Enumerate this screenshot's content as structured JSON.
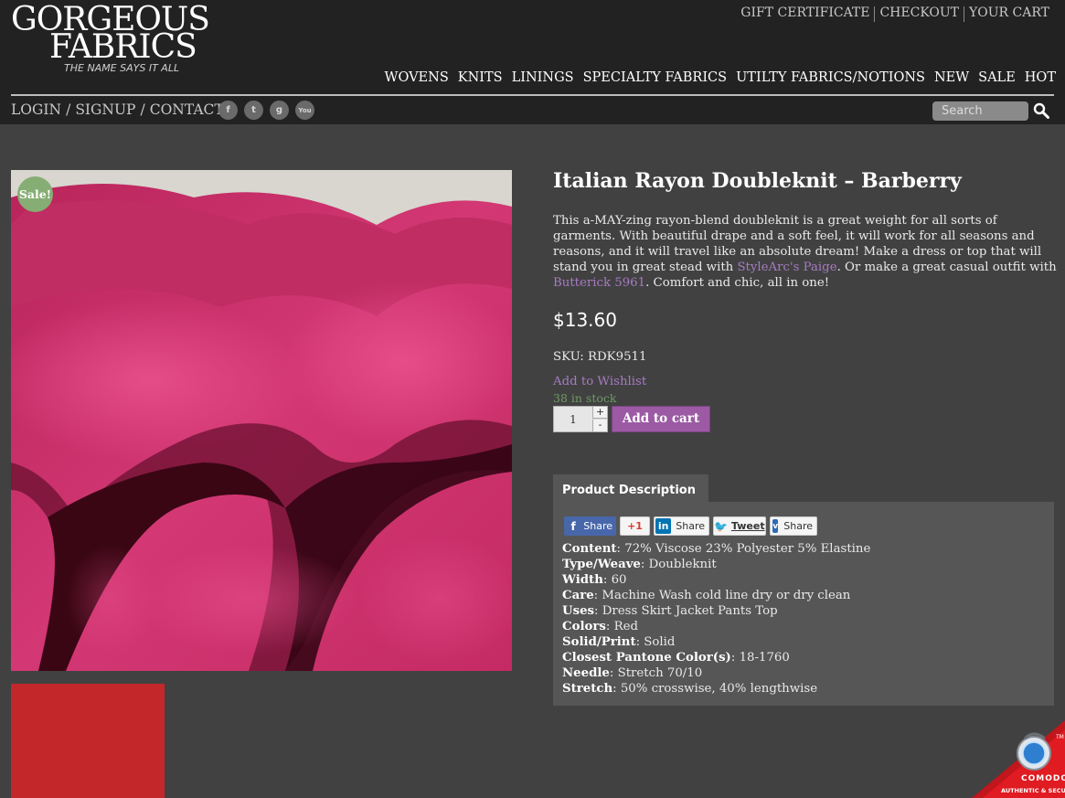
{
  "header": {
    "logo": {
      "line1": "GORGEOUS",
      "line2": "FABRICS",
      "tagline": "THE NAME SAYS IT ALL"
    },
    "utility_nav": [
      "GIFT CERTIFICATE",
      "CHECKOUT",
      "YOUR CART"
    ],
    "main_nav": [
      "WOVENS",
      "KNITS",
      "LININGS",
      "SPECIALTY FABRICS",
      "UTILTY FABRICS/NOTIONS",
      "NEW",
      "SALE",
      "HOT"
    ],
    "account": {
      "login": "LOGIN",
      "signup": "SIGNUP",
      "contact": "CONTACT",
      "separator": "/"
    },
    "socials": [
      {
        "icon": "facebook-icon",
        "glyph": "f"
      },
      {
        "icon": "twitter-icon",
        "glyph": "t"
      },
      {
        "icon": "google-plus-icon",
        "glyph": "g"
      },
      {
        "icon": "youtube-icon",
        "glyph": "You"
      }
    ],
    "search": {
      "placeholder": "Search",
      "icon": "search-icon"
    }
  },
  "product": {
    "sale_badge": "Sale!",
    "title": "Italian Rayon Doubleknit – Barberry",
    "description": {
      "part1": "This a-MAY-zing rayon-blend doubleknit is a great weight for all sorts of garments. With beautiful drape and a soft feel, it will work for all seasons and reasons, and it will travel like an absolute dream! Make a dress or top that will stand you in great stead with ",
      "link1": "StyleArc's Paige",
      "part2": ". Or make a great casual outfit with ",
      "link2": "Butterick 5961",
      "part3": ". Comfort and chic, all in one!"
    },
    "price": "$13.60",
    "sku": "SKU: RDK9511",
    "wishlist": "Add to Wishlist",
    "stock": "38 in stock",
    "quantity": "1",
    "qty_plus": "+",
    "qty_minus": "-",
    "add_to_cart": "Add to cart",
    "image_color": "#c72d64",
    "thumb_color": "#c4272a"
  },
  "tabs": {
    "description_tab": "Product Description"
  },
  "share": {
    "facebook": "Share",
    "googleplus": "+1",
    "linkedin": "Share",
    "twitter": "Tweet",
    "vk": "Share"
  },
  "specs": [
    {
      "label": "Content",
      "value": ": 72% Viscose 23% Polyester 5% Elastine"
    },
    {
      "label": "Type/Weave",
      "value": ": Doubleknit"
    },
    {
      "label": "Width",
      "value": ": 60"
    },
    {
      "label": "Care",
      "value": ": Machine Wash cold line dry or dry clean"
    },
    {
      "label": "Uses",
      "value": ": Dress Skirt Jacket Pants Top"
    },
    {
      "label": "Colors",
      "value": ": Red"
    },
    {
      "label": "Solid/Print",
      "value": ": Solid"
    },
    {
      "label": "Closest Pantone Color(s)",
      "value": ": 18-1760"
    },
    {
      "label": "Needle",
      "value": ": Stretch 70/10"
    },
    {
      "label": "Stretch",
      "value": ": 50% crosswise, 40% lengthwise"
    }
  ],
  "trust_badge": {
    "brand": "COMODO",
    "caption": "AUTHENTIC & SECURE",
    "tm": "TM"
  },
  "colors": {
    "accent_purple": "#9b5aa3",
    "link_purple": "#a77bc2",
    "stock_green": "#6f9a63",
    "sale_green": "#86ae74"
  }
}
